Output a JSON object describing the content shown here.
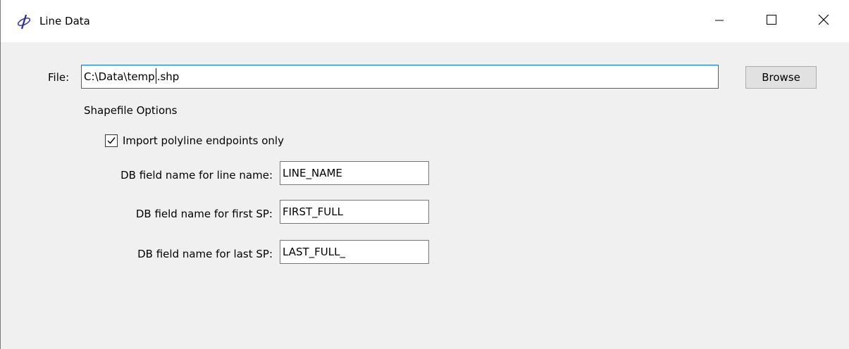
{
  "window": {
    "title": "Line Data",
    "icon": "app-icon",
    "controls": [
      "minimize-icon",
      "maximize-icon",
      "close-icon"
    ]
  },
  "file": {
    "label": "File:",
    "value_before_caret": "C:\\Data\\temp",
    "value_after_caret": ".shp",
    "browse_label": "Browse"
  },
  "shapefile_options": {
    "heading": "Shapefile Options",
    "import_endpoints_label": "Import polyline endpoints only",
    "import_endpoints_checked": true,
    "line_name": {
      "label": "DB field name for line name:",
      "value": "LINE_NAME"
    },
    "first_sp": {
      "label": "DB field name for first SP:",
      "value": "FIRST_FULL"
    },
    "last_sp": {
      "label": "DB field name for last SP:",
      "value": "LAST_FULL_"
    }
  }
}
